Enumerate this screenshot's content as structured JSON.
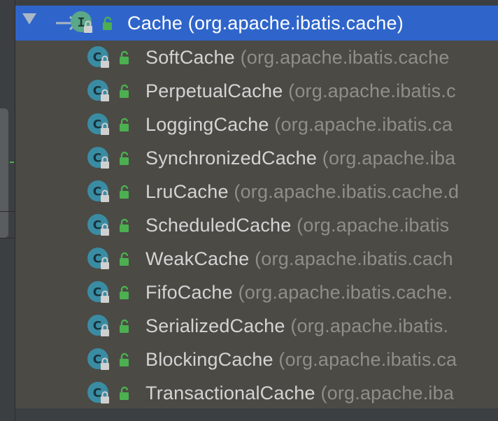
{
  "tree": {
    "root": {
      "name": "Cache",
      "package": "(org.apache.ibatis.cache)",
      "icon": "interface-icon",
      "selected": true
    },
    "children": [
      {
        "name": "SoftCache",
        "package": "(org.apache.ibatis.cache"
      },
      {
        "name": "PerpetualCache",
        "package": "(org.apache.ibatis.c"
      },
      {
        "name": "LoggingCache",
        "package": "(org.apache.ibatis.ca"
      },
      {
        "name": "SynchronizedCache",
        "package": "(org.apache.iba"
      },
      {
        "name": "LruCache",
        "package": "(org.apache.ibatis.cache.d"
      },
      {
        "name": "ScheduledCache",
        "package": "(org.apache.ibatis"
      },
      {
        "name": "WeakCache",
        "package": "(org.apache.ibatis.cach"
      },
      {
        "name": "FifoCache",
        "package": "(org.apache.ibatis.cache."
      },
      {
        "name": "SerializedCache",
        "package": "(org.apache.ibatis."
      },
      {
        "name": "BlockingCache",
        "package": "(org.apache.ibatis.ca"
      },
      {
        "name": "TransactionalCache",
        "package": "(org.apache.iba"
      }
    ]
  },
  "colors": {
    "selection": "#2f65ca",
    "tree_bg": "#4b4a45",
    "class_icon": "#3a8ca3",
    "interface_icon": "#5aa78a",
    "access_public": "#4caf50"
  }
}
